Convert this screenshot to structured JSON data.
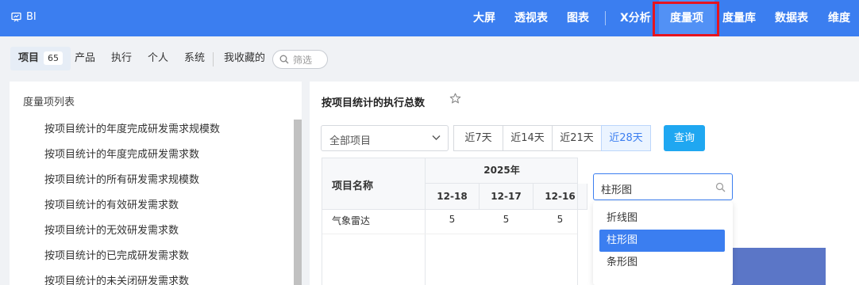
{
  "app": {
    "name": "BI",
    "icon": "dashboard-icon"
  },
  "topnav": {
    "items": [
      {
        "label": "大屏"
      },
      {
        "label": "透视表"
      },
      {
        "label": "图表"
      },
      {
        "label": "X分析"
      },
      {
        "label": "度量项",
        "active": true
      },
      {
        "label": "度量库"
      },
      {
        "label": "数据表"
      },
      {
        "label": "维度"
      }
    ],
    "highlight_color": "#e5141f"
  },
  "subtabs": {
    "items": [
      {
        "label": "项目",
        "count": "65",
        "active": true
      },
      {
        "label": "产品"
      },
      {
        "label": "执行"
      },
      {
        "label": "个人"
      },
      {
        "label": "系统"
      },
      {
        "label": "我收藏的"
      }
    ],
    "filter_label": "筛选"
  },
  "left_panel": {
    "title": "度量项列表",
    "items": [
      "按项目统计的年度完成研发需求规模数",
      "按项目统计的年度完成研发需求数",
      "按项目统计的所有研发需求规模数",
      "按项目统计的有效研发需求数",
      "按项目统计的无效研发需求数",
      "按项目统计的已完成研发需求数",
      "按项目统计的未关闭研发需求数"
    ]
  },
  "detail": {
    "title": "按项目统计的执行总数",
    "scope_select": "全部项目",
    "ranges": [
      {
        "label": "近7天"
      },
      {
        "label": "近14天"
      },
      {
        "label": "近21天"
      },
      {
        "label": "近28天",
        "active": true
      }
    ],
    "query_label": "查询",
    "table": {
      "name_header": "项目名称",
      "year_header": "2025年",
      "dates": [
        "12-18",
        "12-17",
        "12-16"
      ],
      "rows": [
        {
          "name": "气象雷达",
          "values": [
            "5",
            "5",
            "5"
          ]
        }
      ]
    },
    "chart_type": {
      "value": "柱形图",
      "options": [
        {
          "label": "折线图"
        },
        {
          "label": "柱形图",
          "selected": true
        },
        {
          "label": "条形图"
        }
      ]
    }
  },
  "colors": {
    "primary": "#3b7ef0",
    "query": "#1fa7f1",
    "bar": "#5b76c7"
  }
}
